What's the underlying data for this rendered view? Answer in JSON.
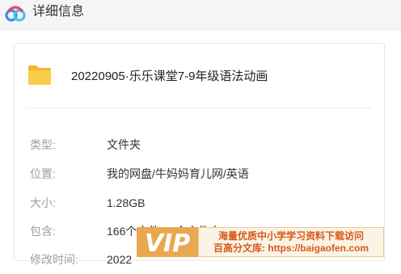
{
  "window": {
    "title": "详细信息",
    "icon": "baidu-netdisk-logo-icon"
  },
  "file": {
    "icon": "folder-icon",
    "name": "20220905·乐乐课堂7-9年级语法动画"
  },
  "details": [
    {
      "label": "类型:",
      "value": "文件夹"
    },
    {
      "label": "位置:",
      "value": "我的网盘/牛妈妈育儿网/英语"
    },
    {
      "label": "大小:",
      "value": "1.28GB"
    },
    {
      "label": "包含:",
      "value": "166个文件,15个文件夹"
    },
    {
      "label": "修改时间:",
      "value": "2022"
    }
  ],
  "watermark": {
    "logo_text": "VIP",
    "line1": "海量优质中小学学习资料下载访问",
    "line2": "百高分文库: https://baigaofen.com"
  },
  "colors": {
    "folder": "#f5c33b",
    "label": "#9aa0a8",
    "value": "#333333",
    "watermark_orange": "#e8a64c",
    "watermark_text": "#d65a1a"
  }
}
